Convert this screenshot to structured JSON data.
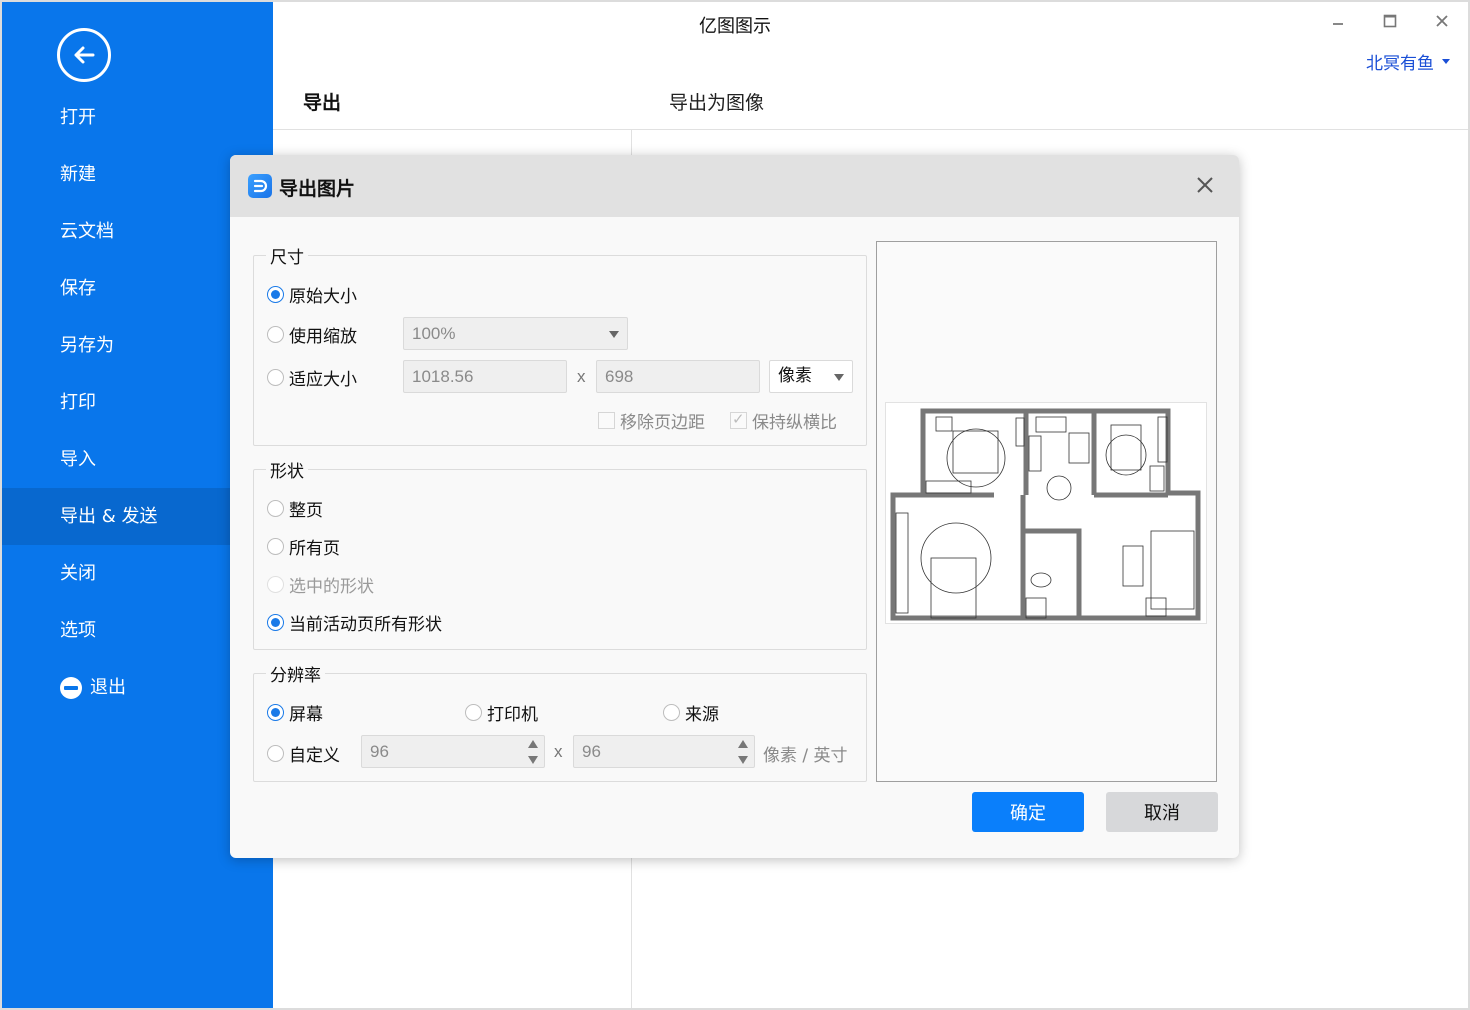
{
  "app": {
    "title": "亿图图示",
    "user_name": "北冥有鱼",
    "window_controls": [
      "minimize",
      "maximize",
      "close"
    ]
  },
  "sidebar": {
    "back_icon": "arrow-left-circle-icon",
    "items": [
      {
        "label": "打开",
        "active": false
      },
      {
        "label": "新建",
        "active": false
      },
      {
        "label": "云文档",
        "active": false
      },
      {
        "label": "保存",
        "active": false
      },
      {
        "label": "另存为",
        "active": false
      },
      {
        "label": "打印",
        "active": false
      },
      {
        "label": "导入",
        "active": false
      },
      {
        "label": "导出 & 发送",
        "active": true
      },
      {
        "label": "关闭",
        "active": false
      },
      {
        "label": "选项",
        "active": false
      },
      {
        "label": "退出",
        "active": false,
        "icon": "minus-circle-icon"
      }
    ]
  },
  "main": {
    "section_title": "导出",
    "subsection_title": "导出为图像"
  },
  "dialog": {
    "title": "导出图片",
    "size_group": {
      "legend": "尺寸",
      "options": [
        {
          "label": "原始大小",
          "checked": true
        },
        {
          "label": "使用缩放",
          "checked": false
        },
        {
          "label": "适应大小",
          "checked": false
        }
      ],
      "zoom_value": "100%",
      "width_value": "1018.56",
      "x_sep": "x",
      "height_value": "698",
      "unit_value": "像素",
      "remove_margin_label": "移除页边距",
      "remove_margin_checked": false,
      "keep_ratio_label": "保持纵横比",
      "keep_ratio_checked": true
    },
    "shape_group": {
      "legend": "形状",
      "options": [
        {
          "label": "整页",
          "checked": false,
          "disabled": false
        },
        {
          "label": "所有页",
          "checked": false,
          "disabled": false
        },
        {
          "label": "选中的形状",
          "checked": false,
          "disabled": true
        },
        {
          "label": "当前活动页所有形状",
          "checked": true,
          "disabled": false
        }
      ]
    },
    "resolution_group": {
      "legend": "分辨率",
      "options": [
        {
          "label": "屏幕",
          "checked": true
        },
        {
          "label": "打印机",
          "checked": false
        },
        {
          "label": "来源",
          "checked": false
        },
        {
          "label": "自定义",
          "checked": false
        }
      ],
      "dpi_x": "96",
      "x_sep": "x",
      "dpi_y": "96",
      "unit_label": "像素 / 英寸"
    },
    "preview": {
      "content": "floor-plan"
    },
    "ok_label": "确定",
    "cancel_label": "取消"
  }
}
